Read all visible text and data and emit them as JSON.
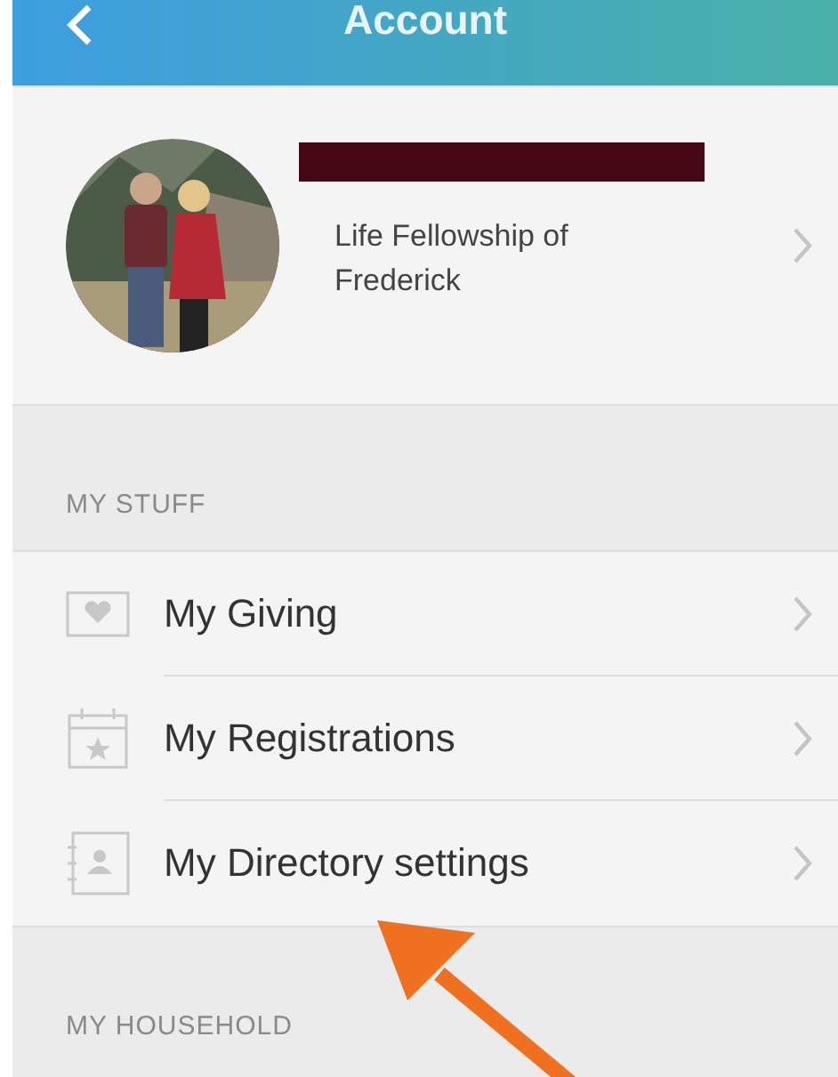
{
  "header": {
    "title": "Account"
  },
  "profile": {
    "subtitle": "Life Fellowship of Frederick"
  },
  "sections": [
    {
      "title": "MY STUFF",
      "items": [
        {
          "label": "My Giving",
          "kind": "giving"
        },
        {
          "label": "My Registrations",
          "kind": "registration"
        },
        {
          "label": "My Directory settings",
          "kind": "directory"
        }
      ]
    },
    {
      "title": "MY HOUSEHOLD"
    }
  ]
}
